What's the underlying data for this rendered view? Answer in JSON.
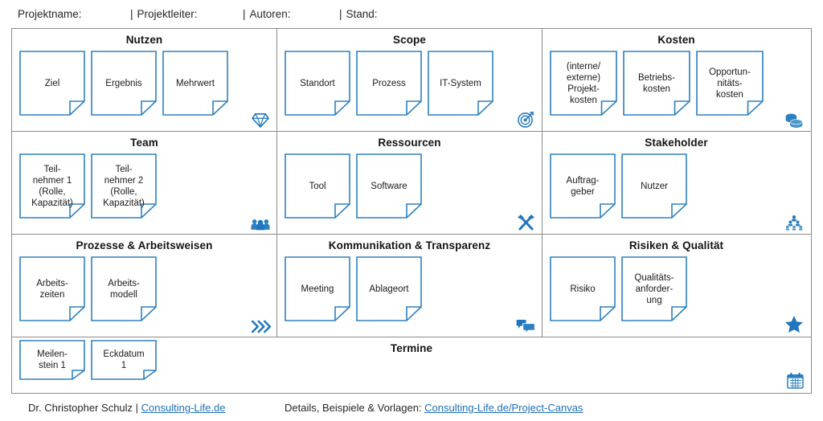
{
  "header": {
    "fields": [
      {
        "label": "Projektname:",
        "separator": ""
      },
      {
        "label": "Projektleiter:",
        "separator": "|"
      },
      {
        "label": "Autoren:",
        "separator": "|"
      },
      {
        "label": "Stand:",
        "separator": "|"
      }
    ]
  },
  "colors": {
    "accent": "#1f76bc",
    "note_border": "#2e81c0",
    "frame": "#8c8c8c",
    "link": "#1f6fb4",
    "text": "#1a1a1a"
  },
  "canvas": {
    "rows": [
      {
        "cells": [
          {
            "title": "Nutzen",
            "icon": "diamond-icon",
            "notes": [
              {
                "text": "Ziel"
              },
              {
                "text": "Ergebnis"
              },
              {
                "text": "Mehrwert"
              }
            ]
          },
          {
            "title": "Scope",
            "icon": "target-icon",
            "notes": [
              {
                "text": "Standort"
              },
              {
                "text": "Prozess"
              },
              {
                "text": "IT-System"
              }
            ]
          },
          {
            "title": "Kosten",
            "icon": "coins-icon",
            "notes": [
              {
                "text": "(interne/\nexterne)\nProjekt-\nkosten"
              },
              {
                "text": "Betriebs-\nkosten"
              },
              {
                "text": "Opportun-\nnitäts-\nkosten"
              }
            ]
          }
        ]
      },
      {
        "cells": [
          {
            "title": "Team",
            "icon": "people-group-icon",
            "notes": [
              {
                "text": "Teil-\nnehmer 1\n(Rolle,\nKapazität)"
              },
              {
                "text": "Teil-\nnehmer 2\n(Rolle,\nKapazität)"
              }
            ]
          },
          {
            "title": "Ressourcen",
            "icon": "hammer-wrench-icon",
            "notes": [
              {
                "text": "Tool"
              },
              {
                "text": "Software"
              }
            ]
          },
          {
            "title": "Stakeholder",
            "icon": "org-pyramid-icon",
            "notes": [
              {
                "text": "Auftrag-\ngeber"
              },
              {
                "text": "Nutzer"
              }
            ]
          }
        ]
      },
      {
        "cells": [
          {
            "title": "Prozesse & Arbeitsweisen",
            "icon": "double-chevron-right-icon",
            "notes": [
              {
                "text": "Arbeits-\nzeiten"
              },
              {
                "text": "Arbeits-\nmodell"
              }
            ]
          },
          {
            "title": "Kommunikation & Transparenz",
            "icon": "chat-bubbles-icon",
            "notes": [
              {
                "text": "Meeting"
              },
              {
                "text": "Ablageort"
              }
            ]
          },
          {
            "title": "Risiken & Qualität",
            "icon": "star-icon",
            "notes": [
              {
                "text": "Risiko"
              },
              {
                "text": "Qualitäts-\nanforder-\nung"
              }
            ]
          }
        ]
      },
      {
        "cells": [
          {
            "title": "Termine",
            "icon": "calendar-icon",
            "notes": [
              {
                "text": "Meilen-\nstein 1"
              },
              {
                "text": "Eckdatum\n1"
              }
            ]
          }
        ]
      }
    ]
  },
  "footer": {
    "author_prefix": "Dr. Christopher Schulz | ",
    "author_link": "Consulting-Life.de",
    "details_prefix": "Details, Beispiele & Vorlagen: ",
    "details_link": "Consulting-Life.de/Project-Canvas"
  }
}
